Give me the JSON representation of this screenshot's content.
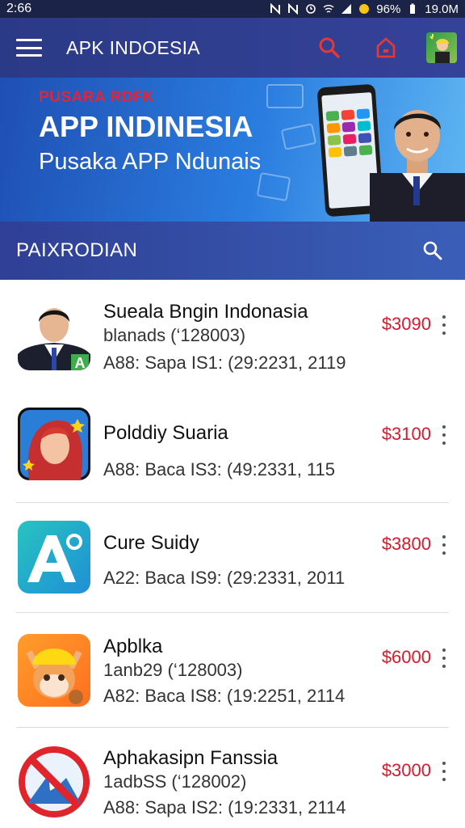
{
  "status_bar": {
    "time": "2:66",
    "battery": "96%",
    "clock_right": "19.0M"
  },
  "app_bar": {
    "title": "APK INDOESIA",
    "icons": [
      "menu-icon",
      "search-icon",
      "home-icon",
      "profile-avatar"
    ],
    "accent": "#e53935"
  },
  "banner": {
    "kicker": "PUSARA RDFK",
    "title": "APP INDINESIA",
    "subtitle": "Pusaka APP Ndunais"
  },
  "section": {
    "title": "PAIXRODIAN"
  },
  "apps": [
    {
      "name": "Sueala Bngin Indonasia",
      "meta1": "blanads  (‘128003)",
      "meta2": "A88: Sapa IS1: (29:2231, 2119",
      "price": "$3090",
      "icon": "man-in-suit-icon"
    },
    {
      "name": "Polddiy Suaria",
      "meta1": "",
      "meta2": "A88: Baca IS3: (49:2331, 115",
      "price": "$3100",
      "icon": "red-hair-woman-icon"
    },
    {
      "name": "Cure Suidy",
      "meta1": "",
      "meta2": "A22: Baca IS9: (29:2331, 2011",
      "price": "$3800",
      "icon": "letter-a-icon"
    },
    {
      "name": "Apblka",
      "meta1": "1anb29  (‘128003)",
      "meta2": "A82: Baca IS8: (19:2251, 2114",
      "price": "$6000",
      "icon": "cat-hardhat-icon"
    },
    {
      "name": "Aphakasipn Fanssia",
      "meta1": "1adbSS  (‘128002)",
      "meta2": "A88: Sapa IS2: (19:2331, 2114",
      "price": "$3000",
      "icon": "no-mountain-icon"
    }
  ]
}
